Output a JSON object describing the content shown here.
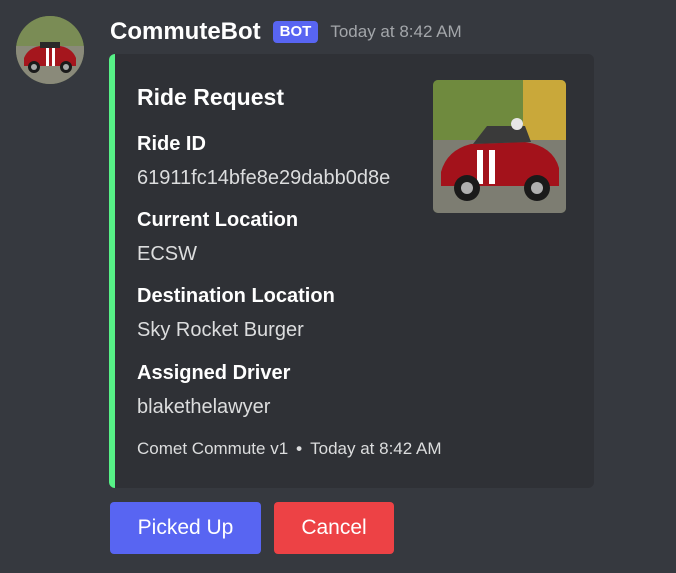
{
  "message": {
    "author": "CommuteBot",
    "bot_tag": "BOT",
    "timestamp": "Today at 8:42 AM",
    "avatar_icon": "red-convertible-car-photo"
  },
  "embed": {
    "accent_color": "#57f287",
    "title": "Ride Request",
    "thumbnail_icon": "red-convertible-car-photo",
    "fields": [
      {
        "name": "Ride ID",
        "value": "61911fc14bfe8e29dabb0d8e"
      },
      {
        "name": "Current Location",
        "value": "ECSW"
      },
      {
        "name": "Destination Location",
        "value": "Sky Rocket Burger"
      },
      {
        "name": "Assigned Driver",
        "value": "blakethelawyer"
      }
    ],
    "footer": {
      "text": "Comet Commute v1",
      "separator": "•",
      "timestamp": "Today at 8:42 AM"
    }
  },
  "buttons": {
    "picked_up": {
      "label": "Picked Up",
      "color": "#5865f2"
    },
    "cancel": {
      "label": "Cancel",
      "color": "#ed4245"
    }
  }
}
